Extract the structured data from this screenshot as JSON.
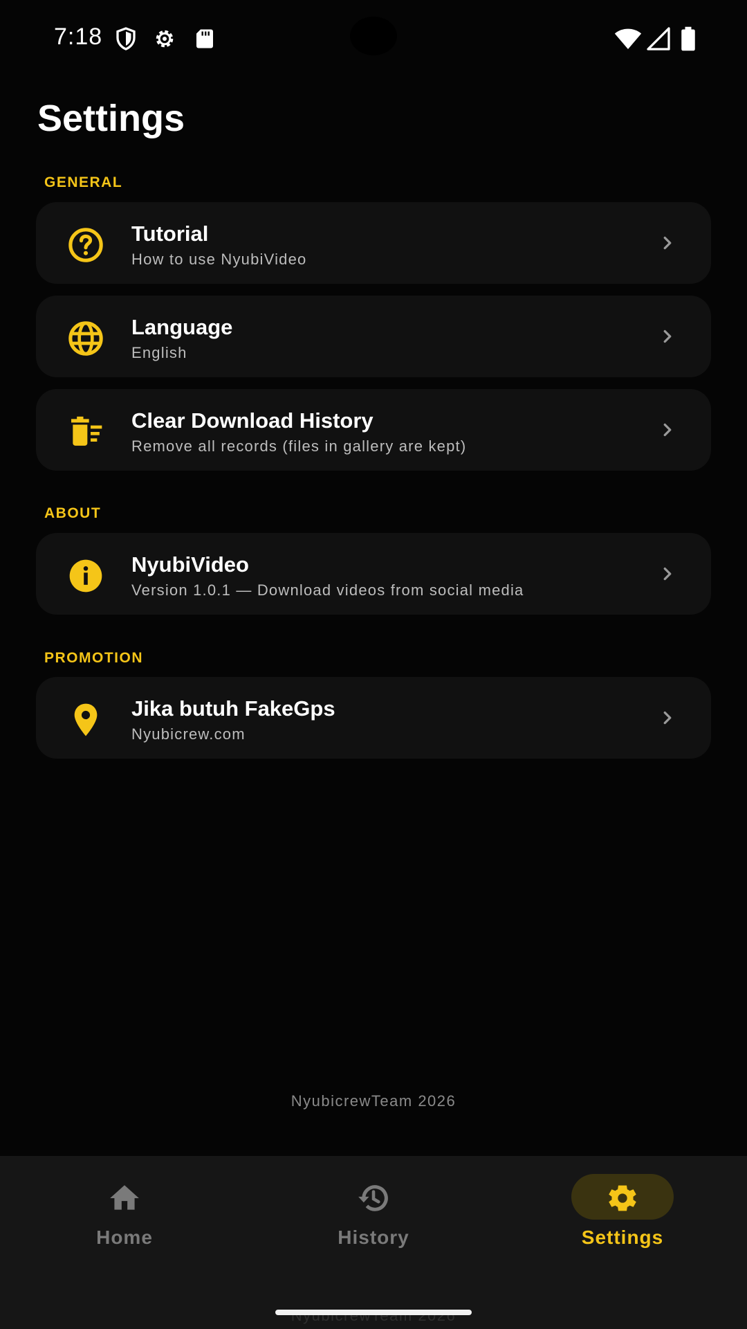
{
  "status_bar": {
    "time": "7:18"
  },
  "header": {
    "title": "Settings"
  },
  "sections": {
    "general": {
      "label": "GENERAL",
      "items": [
        {
          "title": "Tutorial",
          "subtitle": "How to use NyubiVideo",
          "icon": "help-circle-icon"
        },
        {
          "title": "Language",
          "subtitle": "English",
          "icon": "globe-icon"
        },
        {
          "title": "Clear Download History",
          "subtitle": "Remove all records (files in gallery are kept)",
          "icon": "delete-sweep-icon"
        }
      ]
    },
    "about": {
      "label": "ABOUT",
      "items": [
        {
          "title": "NyubiVideo",
          "subtitle": "Version 1.0.1 — Download videos from social media",
          "icon": "info-icon"
        }
      ]
    },
    "promotion": {
      "label": "PROMOTION",
      "items": [
        {
          "title": "Jika butuh FakeGps",
          "subtitle": "Nyubicrew.com",
          "icon": "location-pin-icon"
        }
      ]
    }
  },
  "footer": {
    "text": "NyubicrewTeam 2026"
  },
  "bottom_nav": {
    "items": [
      {
        "label": "Home",
        "icon": "home-icon",
        "active": false
      },
      {
        "label": "History",
        "icon": "history-icon",
        "active": false
      },
      {
        "label": "Settings",
        "icon": "gear-icon",
        "active": true
      }
    ]
  },
  "colors": {
    "accent": "#f5c518",
    "background": "#050505",
    "card": "#111111",
    "nav": "#161616"
  }
}
